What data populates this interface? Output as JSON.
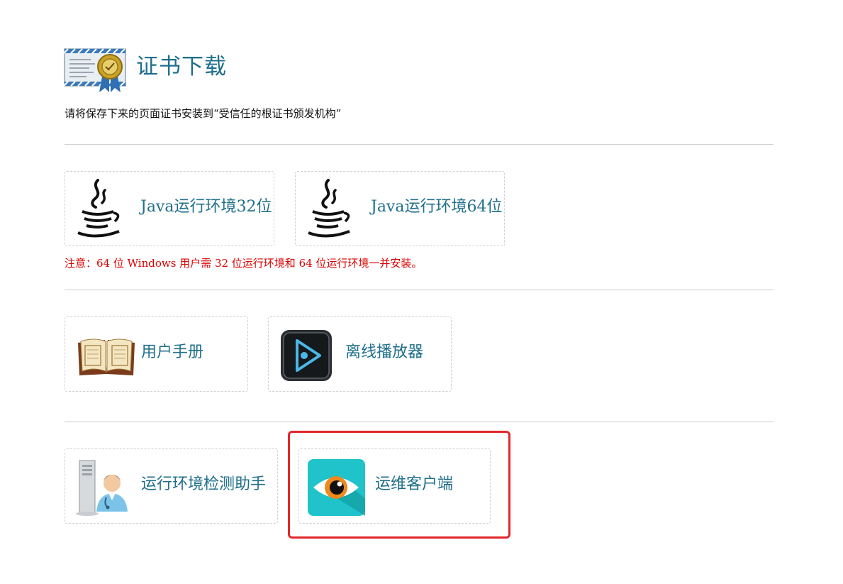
{
  "header": {
    "title": "证书下载",
    "icon": "certificate-icon",
    "instruction": "请将保存下来的页面证书安装到“受信任的根证书颁发机构”"
  },
  "downloads": {
    "java32": {
      "label": "Java运行环境32位",
      "icon": "java-icon"
    },
    "java64": {
      "label": "Java运行环境64位",
      "icon": "java-icon"
    },
    "java_note": "注意：64 位 Windows 用户需 32 位运行环境和 64 位运行环境一并安装。",
    "manual": {
      "label": "用户手册",
      "icon": "book-icon"
    },
    "player": {
      "label": "离线播放器",
      "icon": "play-icon"
    },
    "env_check": {
      "label": "运行环境检测助手",
      "icon": "computer-user-icon"
    },
    "ops_client": {
      "label": "运维客户端",
      "icon": "eye-icon"
    }
  },
  "colors": {
    "link": "#1f6f8b",
    "note": "#d90000",
    "highlight": "#e3262a",
    "divider": "#cfcfcf"
  }
}
